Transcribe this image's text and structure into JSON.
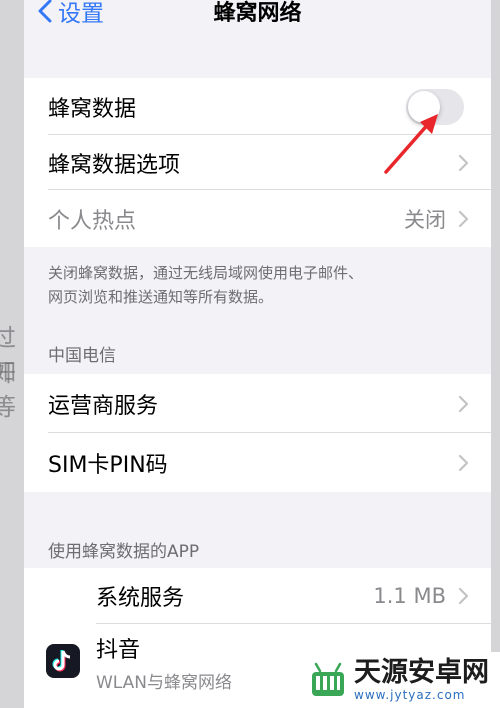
{
  "nav": {
    "back_label": "设置",
    "title": "蜂窝网络"
  },
  "cellular_group": {
    "cellular_data": {
      "label": "蜂窝数据",
      "enabled": false
    },
    "cellular_options": {
      "label": "蜂窝数据选项"
    },
    "hotspot": {
      "label": "个人热点",
      "value": "关闭"
    }
  },
  "footer_text": {
    "line1": "关闭蜂窝数据，通过无线局域网使用电子邮件、",
    "line2": "网页浏览和推送通知等所有数据。"
  },
  "carrier": {
    "header": "中国电信",
    "carrier_services": "运营商服务",
    "sim_pin": "SIM卡PIN码"
  },
  "apps": {
    "header": "使用蜂窝数据的APP",
    "system_services": {
      "label": "系统服务",
      "value": "1.1 MB"
    },
    "douyin": {
      "label": "抖音",
      "subtitle": "WLAN与蜂窝网络"
    }
  },
  "background_ghost": {
    "line1": "过开",
    "line2": "如等"
  },
  "watermark": {
    "name": "天源安卓网",
    "url": "www.jytyaz.com"
  },
  "colors": {
    "accent": "#3478f6",
    "annotation_arrow": "#e8262b",
    "toggle_off": "#e5e5ea"
  }
}
